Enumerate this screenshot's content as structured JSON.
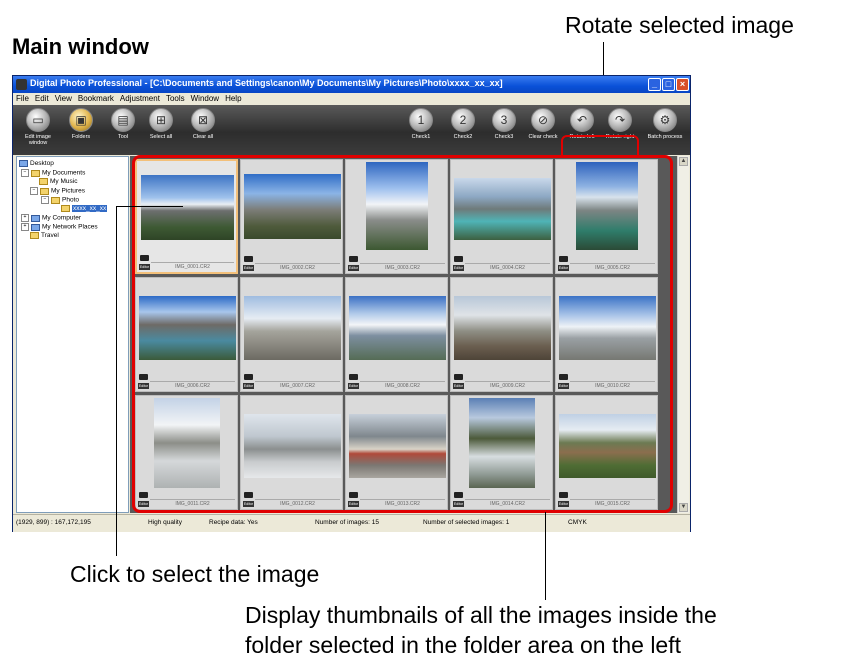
{
  "annotations": {
    "main_window_title": "Main window",
    "rotate_callout": "Rotate selected image",
    "click_callout": "Click to select the image",
    "display_callout_line1": "Display thumbnails of all the images inside the",
    "display_callout_line2": "folder selected in the folder area on the left"
  },
  "app": {
    "title": "Digital Photo Professional - [C:\\Documents and Settings\\canon\\My Documents\\My Pictures\\Photo\\xxxx_xx_xx]",
    "menu": [
      "File",
      "Edit",
      "View",
      "Bookmark",
      "Adjustment",
      "Tools",
      "Window",
      "Help"
    ]
  },
  "toolbar": {
    "edit_image_window": "Edit image window",
    "folders": "Folders",
    "tool": "Tool",
    "select_all": "Select all",
    "clear_all": "Clear all",
    "check1": "Check1",
    "check2": "Check2",
    "check3": "Check3",
    "clear_check": "Clear check",
    "rotate_left": "Rotate left",
    "rotate_right": "Rotate right",
    "batch_process": "Batch process"
  },
  "tree": {
    "desktop": "Desktop",
    "my_documents": "My Documents",
    "my_music": "My Music",
    "my_pictures": "My Pictures",
    "photo": "Photo",
    "selected_folder": "xxxx_xx_xx",
    "my_computer": "My Computer",
    "my_network_places": "My Network Places",
    "travel": "Travel"
  },
  "thumbnails": [
    "IMG_0001.CR2",
    "IMG_0002.CR2",
    "IMG_0003.CR2",
    "IMG_0004.CR2",
    "IMG_0005.CR2",
    "IMG_0006.CR2",
    "IMG_0007.CR2",
    "IMG_0008.CR2",
    "IMG_0009.CR2",
    "IMG_0010.CR2",
    "IMG_0011.CR2",
    "IMG_0012.CR2",
    "IMG_0013.CR2",
    "IMG_0014.CR2",
    "IMG_0015.CR2"
  ],
  "status": {
    "coords": "(1929, 899) : 167,172,195",
    "quality": "High quality",
    "recipe": "Recipe data: Yes",
    "num_images": "Number of images: 15",
    "num_selected": "Number of selected images: 1",
    "colorspace": "CMYK"
  }
}
